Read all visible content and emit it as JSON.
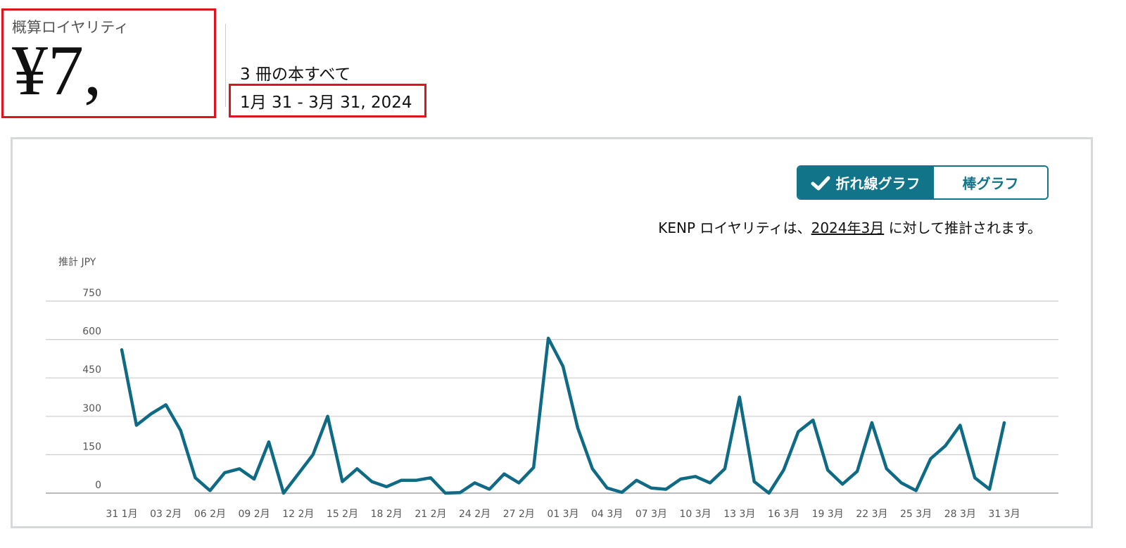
{
  "summary": {
    "royalty_label": "概算ロイヤリティ",
    "royalty_value": "¥7,",
    "books_text": "3 冊の本すべて",
    "date_range": "1月 31 - 3月 31, 2024"
  },
  "toggle": {
    "line_label": "折れ線グラフ",
    "bar_label": "棒グラフ",
    "selected": "line"
  },
  "kenp_note": {
    "prefix": "KENP ロイヤリティは、",
    "link": "2024年3月",
    "suffix": " に対して推計されます。"
  },
  "colors": {
    "accent": "#117488",
    "line": "#0f6a85",
    "highlight_border": "#e0141e",
    "grid": "#cccccc"
  },
  "chart_data": {
    "type": "line",
    "ylabel": "推計 JPY",
    "ylim": [
      0,
      750
    ],
    "yticks": [
      0,
      150,
      300,
      450,
      600,
      750
    ],
    "grid": true,
    "xtick_labels": [
      "31 1月",
      "03 2月",
      "06 2月",
      "09 2月",
      "12 2月",
      "15 2月",
      "18 2月",
      "21 2月",
      "24 2月",
      "27 2月",
      "01 3月",
      "04 3月",
      "07 3月",
      "10 3月",
      "13 3月",
      "16 3月",
      "19 3月",
      "22 3月",
      "25 3月",
      "28 3月",
      "31 3月"
    ],
    "x": [
      "1/31",
      "2/1",
      "2/2",
      "2/3",
      "2/4",
      "2/5",
      "2/6",
      "2/7",
      "2/8",
      "2/9",
      "2/10",
      "2/11",
      "2/12",
      "2/13",
      "2/14",
      "2/15",
      "2/16",
      "2/17",
      "2/18",
      "2/19",
      "2/20",
      "2/21",
      "2/22",
      "2/23",
      "2/24",
      "2/25",
      "2/26",
      "2/27",
      "2/28",
      "2/29",
      "3/1",
      "3/2",
      "3/3",
      "3/4",
      "3/5",
      "3/6",
      "3/7",
      "3/8",
      "3/9",
      "3/10",
      "3/11",
      "3/12",
      "3/13",
      "3/14",
      "3/15",
      "3/16",
      "3/17",
      "3/18",
      "3/19",
      "3/20",
      "3/21",
      "3/22",
      "3/23",
      "3/24",
      "3/25",
      "3/26",
      "3/27",
      "3/28",
      "3/29",
      "3/30",
      "3/31"
    ],
    "values": [
      560,
      265,
      310,
      345,
      245,
      60,
      10,
      80,
      95,
      55,
      200,
      0,
      75,
      150,
      300,
      45,
      95,
      45,
      25,
      50,
      50,
      60,
      0,
      2,
      40,
      15,
      75,
      40,
      100,
      605,
      495,
      255,
      95,
      20,
      3,
      50,
      20,
      15,
      55,
      65,
      40,
      95,
      375,
      45,
      0,
      90,
      240,
      285,
      90,
      35,
      85,
      275,
      95,
      40,
      10,
      135,
      185,
      265,
      60,
      15,
      275
    ]
  }
}
